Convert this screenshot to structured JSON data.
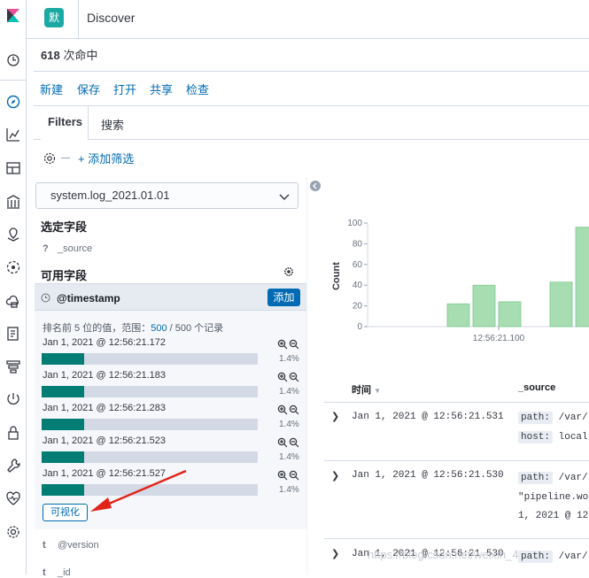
{
  "header": {
    "space_initial": "默",
    "title": "Discover"
  },
  "hits": {
    "count": "618",
    "suffix": "次命中"
  },
  "top_menu": {
    "new": "新建",
    "save": "保存",
    "open": "打开",
    "share": "共享",
    "inspect": "检查"
  },
  "filters": {
    "tab_label": "Filters",
    "search_placeholder": "搜索",
    "add_filter": "+ 添加筛选"
  },
  "sidebar": {
    "index_pattern": "system.log_2021.01.01",
    "selected_fields_title": "选定字段",
    "selected_fields": [
      {
        "type": "?",
        "name": "_source"
      }
    ],
    "available_fields_title": "可用字段",
    "active_field": {
      "name": "@timestamp",
      "add_label": "添加"
    },
    "top5_text": "排名前 5 位的值，范围：",
    "top5_count": "500",
    "top5_total": "/ 500 个记录",
    "top_values": [
      {
        "label": "Jan 1, 2021 @ 12:56:21.172",
        "pct": "1.4%",
        "fraction": 0.014
      },
      {
        "label": "Jan 1, 2021 @ 12:56:21.183",
        "pct": "1.4%",
        "fraction": 0.014
      },
      {
        "label": "Jan 1, 2021 @ 12:56:21.283",
        "pct": "1.4%",
        "fraction": 0.014
      },
      {
        "label": "Jan 1, 2021 @ 12:56:21.523",
        "pct": "1.4%",
        "fraction": 0.014
      },
      {
        "label": "Jan 1, 2021 @ 12:56:21.527",
        "pct": "1.4%",
        "fraction": 0.014
      }
    ],
    "visualize_label": "可视化",
    "other_fields": [
      {
        "type": "t",
        "name": "@version"
      },
      {
        "type": "t",
        "name": "_id"
      }
    ]
  },
  "chart_data": {
    "type": "bar",
    "ylabel": "Count",
    "yticks": [
      "100",
      "80",
      "60",
      "40",
      "20",
      "0"
    ],
    "ylim": [
      0,
      100
    ],
    "xtick": "12:56:21.100",
    "values": [
      22,
      40,
      24,
      43,
      96
    ],
    "color": "#a8dcb1"
  },
  "docs": {
    "time_header": "时间",
    "source_header": "_source",
    "rows": [
      {
        "time": "Jan 1, 2021 @ 12:56:21.531",
        "line1_key": "path:",
        "line1_val": "/var/",
        "line2_key": "host:",
        "line2_val": "local"
      },
      {
        "time": "Jan 1, 2021 @ 12:56:21.530",
        "line1_key": "path:",
        "line1_val": "/var/",
        "line2_text": "\"pipeline.wo",
        "line3_text": "1, 2021 @ 12"
      },
      {
        "time": "Jan 1, 2021 @ 12:56:21.530",
        "line1_key": "path:",
        "line1_val": "/var/"
      }
    ]
  },
  "watermark": "https://blog.csdn.net/weixin_4",
  "colors": {
    "accent": "#006bb4",
    "teal": "#017d73",
    "brand_avatar": "#1ba9a3"
  }
}
